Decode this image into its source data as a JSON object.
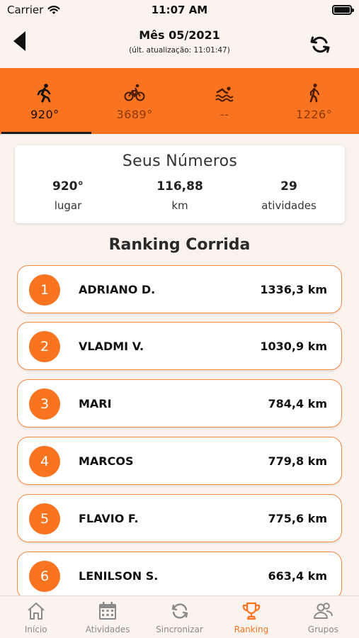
{
  "status_bar": {
    "carrier": "Carrier",
    "time": "11:07 AM"
  },
  "header": {
    "title": "Mês 05/2021",
    "subtitle": "(últ. atualização: 11:01:47)"
  },
  "sport_tabs": [
    {
      "icon": "running-icon",
      "value": "920°",
      "active": true
    },
    {
      "icon": "cycling-icon",
      "value": "3689°",
      "active": false
    },
    {
      "icon": "swimming-icon",
      "value": "--",
      "active": false
    },
    {
      "icon": "walking-icon",
      "value": "1226°",
      "active": false
    }
  ],
  "numbers": {
    "title": "Seus Números",
    "stats": [
      {
        "value": "920°",
        "label": "lugar"
      },
      {
        "value": "116,88",
        "label": "km"
      },
      {
        "value": "29",
        "label": "atividades"
      }
    ]
  },
  "ranking": {
    "title": "Ranking Corrida",
    "rows": [
      {
        "pos": "1",
        "name": "ADRIANO D.",
        "distance": "1336,3 km"
      },
      {
        "pos": "2",
        "name": "VLADMI V.",
        "distance": "1030,9 km"
      },
      {
        "pos": "3",
        "name": "MARI",
        "distance": "784,4 km"
      },
      {
        "pos": "4",
        "name": "MARCOS",
        "distance": "779,8 km"
      },
      {
        "pos": "5",
        "name": "FLAVIO F.",
        "distance": "775,6 km"
      },
      {
        "pos": "6",
        "name": "LENILSON S.",
        "distance": "663,4 km"
      }
    ]
  },
  "bottom_nav": [
    {
      "icon": "home-icon",
      "label": "Início",
      "active": false
    },
    {
      "icon": "calendar-icon",
      "label": "Atividades",
      "active": false
    },
    {
      "icon": "sync-icon",
      "label": "Sincronizar",
      "active": false
    },
    {
      "icon": "trophy-icon",
      "label": "Ranking",
      "active": true
    },
    {
      "icon": "group-icon",
      "label": "Grupos",
      "active": false
    }
  ],
  "colors": {
    "accent": "#f97421",
    "background": "#fbf3ee",
    "inactive": "#8a8a8a"
  }
}
